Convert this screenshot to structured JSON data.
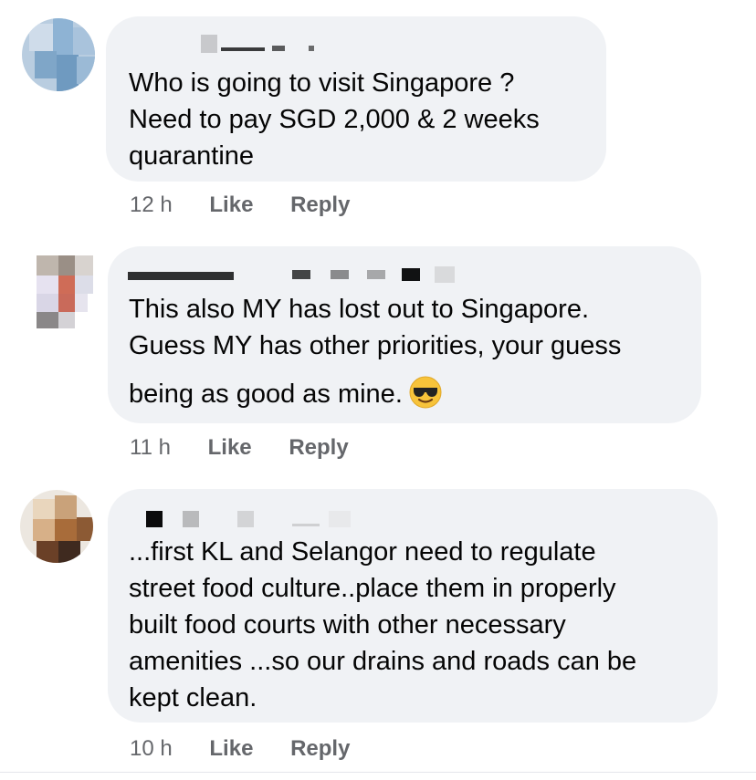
{
  "comments": [
    {
      "author_name": "",
      "lines": [
        "Who is going to visit Singapore ?",
        "Need to pay SGD 2,000 & 2 weeks",
        "quarantine"
      ],
      "time": "12 h",
      "like_label": "Like",
      "reply_label": "Reply"
    },
    {
      "author_name": "",
      "lines": [
        "This also MY has lost out to Singapore.",
        "Guess MY has other priorities, your guess",
        "being as good as mine."
      ],
      "emoji": "smiling-face-with-sunglasses-icon",
      "time": "11 h",
      "like_label": "Like",
      "reply_label": "Reply"
    },
    {
      "author_name": "",
      "lines": [
        "...first KL and Selangor need to regulate",
        "street food culture..place them in properly",
        "built food courts with other necessary",
        "amenities ...so our drains and roads can be",
        "kept clean."
      ],
      "time": "10 h",
      "like_label": "Like",
      "reply_label": "Reply"
    }
  ]
}
